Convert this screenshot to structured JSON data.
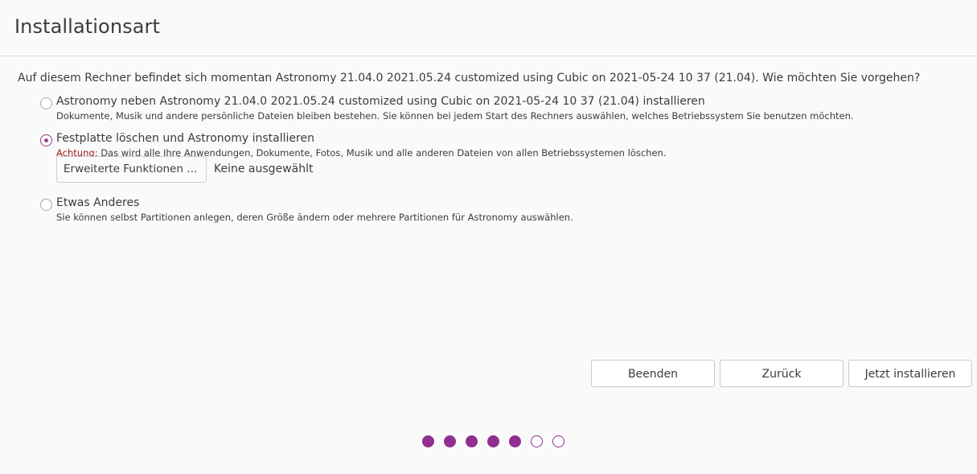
{
  "header": {
    "title": "Installationsart"
  },
  "question": "Auf diesem Rechner befindet sich momentan Astronomy 21.04.0 2021.05.24 customized using Cubic on 2021-05-24 10 37 (21.04). Wie möchten Sie vorgehen?",
  "options": [
    {
      "label": "Astronomy neben Astronomy 21.04.0 2021.05.24 customized using Cubic on 2021-05-24 10 37 (21.04) installieren",
      "description": "Dokumente, Musik und andere persönliche Dateien bleiben bestehen. Sie können bei jedem Start des Rechners auswählen, welches Betriebssystem Sie benutzen möchten.",
      "selected": false
    },
    {
      "label": "Festplatte löschen und Astronomy installieren",
      "warning_word": "Achtung:",
      "description": " Das wird alle Ihre Anwendungen, Dokumente, Fotos, Musik und alle anderen Dateien von allen Betriebssystemen löschen.",
      "selected": true,
      "advanced_button_label": "Erweiterte Funktionen …",
      "advanced_status": "Keine ausgewählt"
    },
    {
      "label": "Etwas Anderes",
      "description": "Sie können selbst Partitionen anlegen, deren Größe ändern oder mehrere Partitionen für Astronomy auswählen.",
      "selected": false
    }
  ],
  "buttons": {
    "quit": "Beenden",
    "back": "Zurück",
    "install_now": "Jetzt installieren"
  },
  "progress": {
    "total_steps": 7,
    "completed_steps": 5
  },
  "colors": {
    "accent": "#8f2f8f",
    "warning": "#a0181a",
    "background": "#fafafa"
  }
}
